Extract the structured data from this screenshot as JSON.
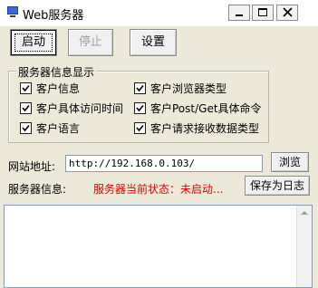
{
  "window": {
    "title": "Web服务器",
    "minimize_icon": "minimize-icon",
    "maximize_icon": "maximize-icon",
    "close_icon": "close-icon",
    "app_icon": "computer-icon"
  },
  "toolbar": {
    "start_label": "启动",
    "stop_label": "停止",
    "settings_label": "设置"
  },
  "group": {
    "title": "服务器信息显示",
    "options": [
      {
        "label": "客户信息",
        "checked": true
      },
      {
        "label": "客户浏览器类型",
        "checked": true
      },
      {
        "label": "客户具体访问时间",
        "checked": true
      },
      {
        "label": "客户Post/Get具体命令",
        "checked": true
      },
      {
        "label": "客户语言",
        "checked": true
      },
      {
        "label": "客户请求接收数据类型",
        "checked": true
      }
    ]
  },
  "url": {
    "label": "网站地址:",
    "value": "http://192.168.0.103/",
    "browse_label": "浏览"
  },
  "info": {
    "label": "服务器信息:",
    "status": "服务器当前状态：未启动...",
    "save_label": "保存为日志",
    "status_color": "#e00000"
  },
  "log": {
    "content": ""
  }
}
